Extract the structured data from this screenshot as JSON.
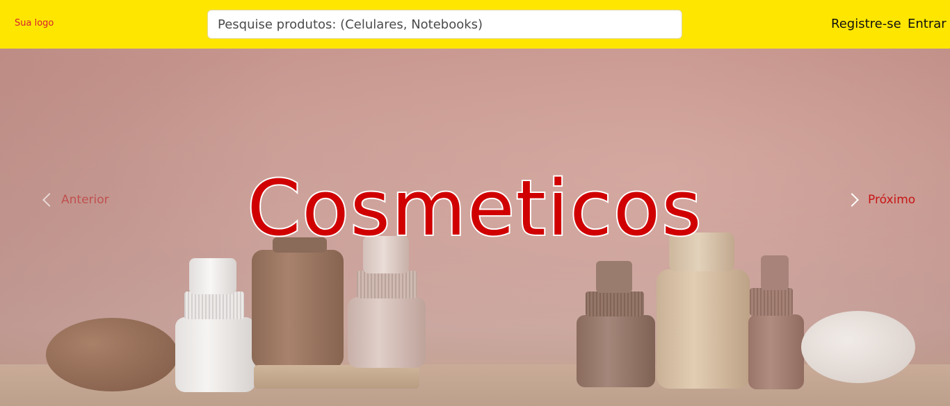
{
  "header": {
    "logo_text": "Sua logo",
    "search_placeholder": "Pesquise produtos: (Celulares, Notebooks)",
    "register_label": "Registre-se",
    "login_label": "Entrar",
    "background_color": "#ffe600"
  },
  "hero": {
    "title": "Cosmeticos",
    "prev_label": "Anterior",
    "next_label": "Próximo",
    "title_color": "#d00000",
    "prev_icon": "chevron-left-icon",
    "next_icon": "chevron-right-icon"
  }
}
